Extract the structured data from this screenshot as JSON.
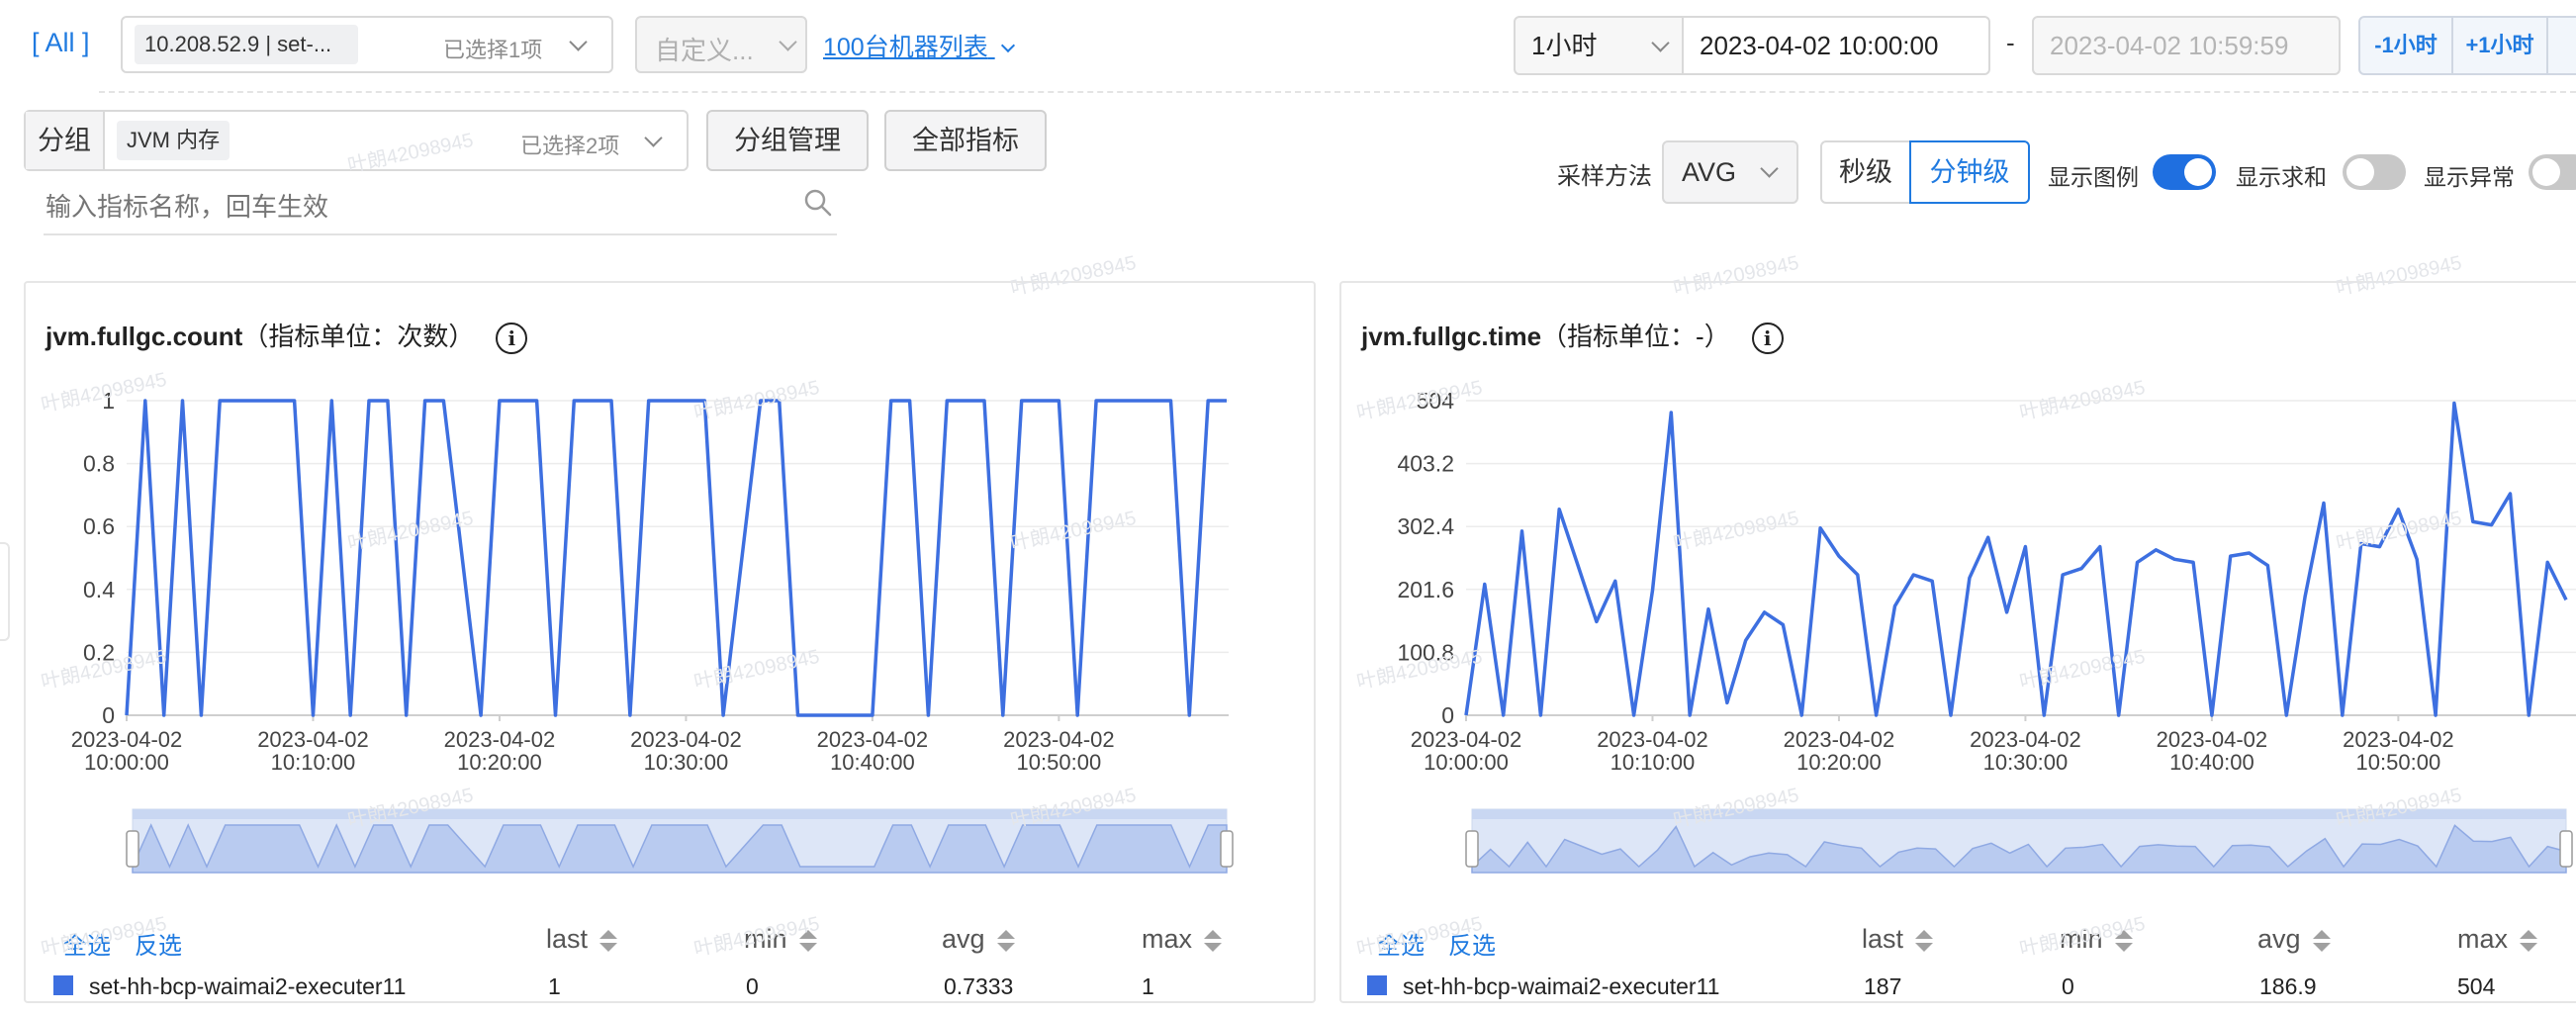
{
  "filters": {
    "all_label": "[ All ]",
    "host_tag": "10.208.52.9 | set-...",
    "host_hint": "已选择1项",
    "custom_placeholder": "自定义...",
    "machine_list_link": "100台机器列表"
  },
  "time_range": {
    "duration": "1小时",
    "start": "2023-04-02 10:00:00",
    "separator": "-",
    "end": "2023-04-02 10:59:59",
    "minus_label": "-1小时",
    "plus_label": "+1小时"
  },
  "group": {
    "label": "分组",
    "tag": "JVM 内存",
    "hint": "已选择2项",
    "manage_button": "分组管理",
    "all_metrics_button": "全部指标",
    "search_placeholder": "输入指标名称，回车生效"
  },
  "options": {
    "sampling_label": "采样方法",
    "sampling_value": "AVG",
    "second_level": "秒级",
    "minute_level": "分钟级",
    "show_legend": "显示图例",
    "show_legend_on": true,
    "show_sum": "显示求和",
    "show_sum_on": false,
    "show_anomaly": "显示异常",
    "show_anomaly_on": false
  },
  "watermark": "叶朗42098945",
  "table": {
    "select_all": "全选",
    "invert": "反选",
    "columns": [
      "last",
      "min",
      "avg",
      "max"
    ]
  },
  "panels": [
    {
      "metric": "jvm.fullgc.count",
      "unit_label": "（指标单位：次数）",
      "series_name": "set-hh-bcp-waimai2-executer11",
      "stats": {
        "last": "1",
        "min": "0",
        "avg": "0.7333",
        "max": "1"
      }
    },
    {
      "metric": "jvm.fullgc.time",
      "unit_label": "（指标单位：-）",
      "series_name": "set-hh-bcp-waimai2-executer11",
      "stats": {
        "last": "187",
        "min": "0",
        "avg": "186.9",
        "max": "504"
      }
    }
  ],
  "chart_data": [
    {
      "type": "line",
      "series_color": "#3d6fe0",
      "x_ticks": [
        "2023-04-02 10:00:00",
        "2023-04-02 10:10:00",
        "2023-04-02 10:20:00",
        "2023-04-02 10:30:00",
        "2023-04-02 10:40:00",
        "2023-04-02 10:50:00"
      ],
      "y_ticks": [
        "0",
        "0.2",
        "0.4",
        "0.6",
        "0.8",
        "1"
      ],
      "ylim": [
        0,
        1
      ],
      "x_range_min": [
        0,
        59
      ],
      "grid": true,
      "series": [
        {
          "name": "set-hh-bcp-waimai2-executer11",
          "x": [
            0,
            1,
            2,
            3,
            4,
            5,
            9,
            10,
            11,
            12,
            13,
            14,
            15,
            16,
            17,
            19,
            20,
            22,
            23,
            24,
            26,
            27,
            28,
            31,
            32,
            34,
            35,
            36,
            40,
            41,
            42,
            43,
            44,
            46,
            47,
            48,
            50,
            51,
            52,
            56,
            57,
            58,
            59
          ],
          "values": [
            0,
            1,
            0,
            1,
            0,
            1,
            1,
            0,
            1,
            0,
            1,
            1,
            0,
            1,
            1,
            0,
            1,
            1,
            0,
            1,
            1,
            0,
            1,
            1,
            0,
            1,
            1,
            0,
            0,
            1,
            1,
            0,
            1,
            1,
            0,
            1,
            1,
            0,
            1,
            1,
            0,
            1,
            1
          ]
        }
      ]
    },
    {
      "type": "line",
      "series_color": "#3d6fe0",
      "x_ticks": [
        "2023-04-02 10:00:00",
        "2023-04-02 10:10:00",
        "2023-04-02 10:20:00",
        "2023-04-02 10:30:00",
        "2023-04-02 10:40:00",
        "2023-04-02 10:50:00"
      ],
      "y_ticks": [
        "0",
        "100.8",
        "201.6",
        "302.4",
        "403.2",
        "504"
      ],
      "ylim": [
        0,
        504
      ],
      "x_range_min": [
        0,
        59
      ],
      "grid": true,
      "series": [
        {
          "name": "set-hh-bcp-waimai2-executer11",
          "x": [
            0,
            1,
            2,
            3,
            4,
            5,
            6,
            7,
            8,
            9,
            10,
            11,
            12,
            13,
            14,
            15,
            16,
            17,
            18,
            19,
            20,
            21,
            22,
            23,
            24,
            25,
            26,
            27,
            28,
            29,
            30,
            31,
            32,
            33,
            34,
            35,
            36,
            37,
            38,
            39,
            40,
            41,
            42,
            43,
            44,
            45,
            46,
            47,
            48,
            49,
            50,
            51,
            52,
            53,
            54,
            55,
            56,
            57,
            58,
            59
          ],
          "values": [
            0,
            210,
            0,
            295,
            0,
            330,
            240,
            150,
            215,
            0,
            200,
            485,
            0,
            170,
            20,
            120,
            165,
            145,
            0,
            300,
            255,
            225,
            0,
            175,
            225,
            215,
            0,
            220,
            285,
            165,
            270,
            0,
            225,
            235,
            270,
            0,
            245,
            265,
            250,
            245,
            0,
            255,
            260,
            240,
            0,
            190,
            340,
            0,
            275,
            270,
            330,
            250,
            0,
            500,
            310,
            305,
            355,
            0,
            245,
            185
          ]
        }
      ]
    }
  ]
}
